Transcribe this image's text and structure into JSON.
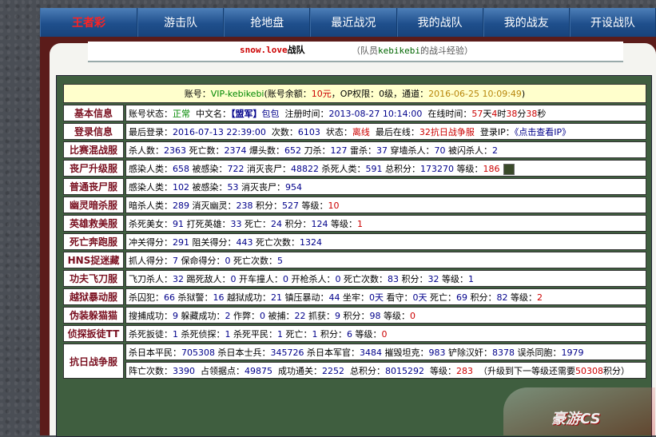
{
  "nav": {
    "items": [
      "王者彩",
      "游击队",
      "抢地盘",
      "最近战况",
      "我的战队",
      "我的战友",
      "开设战队"
    ]
  },
  "tab": {
    "squad_name": "snow.love",
    "squad_suffix": "战队",
    "sub_prefix": "（队员",
    "sub_member": "kebikebi",
    "sub_suffix": "的战斗经验）"
  },
  "account": {
    "label": "账号：",
    "id": "VIP-kebikebi",
    "balance_label": "(账号余额：",
    "balance": "10元",
    "op_label": "，OP权限：",
    "op": "0级",
    "channel_label": "，通道：",
    "channel": "2016-06-25 10:09:49",
    "end": ")"
  },
  "rows": [
    {
      "label": "基本信息"
    },
    {
      "label": "登录信息"
    },
    {
      "label": "比赛混战服"
    },
    {
      "label": "丧尸升级服"
    },
    {
      "label": "普通丧尸服"
    },
    {
      "label": "幽灵暗杀服"
    },
    {
      "label": "英雄救美服"
    },
    {
      "label": "死亡奔跑服"
    },
    {
      "label": "HNS捉迷藏"
    },
    {
      "label": "功夫飞刀服"
    },
    {
      "label": "越狱暴动服"
    },
    {
      "label": "伪装躲猫猫"
    },
    {
      "label": "侦探扳徒TT"
    },
    {
      "label": "抗日战争服"
    }
  ],
  "basic": {
    "status_label": "账号状态：",
    "status": "正常",
    "cn_label": "中文名：",
    "cn_tag": "【盟军】",
    "cn_name": "包包",
    "reg_label": "注册时间：",
    "reg": "2013-08-27 10:14:00",
    "online_label": "在线时间：",
    "d": "57",
    "d_u": "天",
    "h": "4",
    "h_u": "时",
    "m": "38",
    "m_u": "分",
    "s": "38",
    "s_u": "秒"
  },
  "login": {
    "last_label": "最后登录：",
    "last": "2016-07-13 22:39:00",
    "count_label": "次数：",
    "count": "6103",
    "state_label": "状态：",
    "state": "离线",
    "where_label": "最后在线：",
    "where": "32抗日战争服",
    "ip_label": "登录IP：",
    "ip": "《点击查看IP》"
  },
  "r3": [
    {
      "k": "杀人数：",
      "v": "2363"
    },
    {
      "k": "死亡数：",
      "v": "2374"
    },
    {
      "k": "爆头数：",
      "v": "652"
    },
    {
      "k": "刀杀：",
      "v": "127"
    },
    {
      "k": "雷杀：",
      "v": "37"
    },
    {
      "k": "穿墙杀人：",
      "v": "70"
    },
    {
      "k": "被闪杀人：",
      "v": "2"
    }
  ],
  "r4": [
    {
      "k": "感染人类：",
      "v": "658"
    },
    {
      "k": "被感染：",
      "v": "722"
    },
    {
      "k": "消灭丧尸：",
      "v": "48822"
    },
    {
      "k": "杀死人类：",
      "v": "591"
    },
    {
      "k": "总积分：",
      "v": "173270"
    },
    {
      "k": "等级：",
      "v": "186",
      "red": true
    }
  ],
  "r5": [
    {
      "k": "感染人类：",
      "v": "102"
    },
    {
      "k": "被感染：",
      "v": "53"
    },
    {
      "k": "消灭丧尸：",
      "v": "954"
    }
  ],
  "r6": [
    {
      "k": "暗杀人类：",
      "v": "289"
    },
    {
      "k": "消灭幽灵：",
      "v": "238"
    },
    {
      "k": "积分：",
      "v": "527"
    },
    {
      "k": "等级：",
      "v": "10",
      "red": true
    }
  ],
  "r7": [
    {
      "k": "杀死美女：",
      "v": "91"
    },
    {
      "k": "打死英雄：",
      "v": "33"
    },
    {
      "k": "死亡：",
      "v": "24"
    },
    {
      "k": "积分：",
      "v": "124"
    },
    {
      "k": "等级：",
      "v": "1",
      "red": true
    }
  ],
  "r8": [
    {
      "k": "冲关得分：",
      "v": "291"
    },
    {
      "k": "阻关得分：",
      "v": "443"
    },
    {
      "k": "死亡次数：",
      "v": "1324"
    }
  ],
  "r9": [
    {
      "k": "抓人得分：",
      "v": "7"
    },
    {
      "k": "保命得分：",
      "v": "0"
    },
    {
      "k": "死亡次数：",
      "v": "5"
    }
  ],
  "r10": [
    {
      "k": "飞刀杀人：",
      "v": "32"
    },
    {
      "k": "踢死敌人：",
      "v": "0"
    },
    {
      "k": "开车撞人：",
      "v": "0"
    },
    {
      "k": "开枪杀人：",
      "v": "0"
    },
    {
      "k": "死亡次数：",
      "v": "83"
    },
    {
      "k": "积分：",
      "v": "32"
    },
    {
      "k": "等级：",
      "v": "1"
    }
  ],
  "r11": [
    {
      "k": "杀囚犯：",
      "v": "66"
    },
    {
      "k": "杀狱警：",
      "v": "16"
    },
    {
      "k": "越狱成功：",
      "v": "21"
    },
    {
      "k": "镇压暴动：",
      "v": "44"
    },
    {
      "k": "坐牢：",
      "v": "0天"
    },
    {
      "k": "看守：",
      "v": "0天"
    },
    {
      "k": "死亡：",
      "v": "69"
    },
    {
      "k": "积分：",
      "v": "82"
    },
    {
      "k": "等级：",
      "v": "2",
      "red": true
    }
  ],
  "r12": [
    {
      "k": "搜捕成功：",
      "v": "9"
    },
    {
      "k": "躲藏成功：",
      "v": "2"
    },
    {
      "k": "作弊：",
      "v": "0"
    },
    {
      "k": "被捕：",
      "v": "22"
    },
    {
      "k": "抓获：",
      "v": "9"
    },
    {
      "k": "积分：",
      "v": "98"
    },
    {
      "k": "等级：",
      "v": "0",
      "red": true
    }
  ],
  "r13": [
    {
      "k": "杀死扳徒：",
      "v": "1"
    },
    {
      "k": "杀死侦探：",
      "v": "1"
    },
    {
      "k": "杀死平民：",
      "v": "1"
    },
    {
      "k": "死亡：",
      "v": "1"
    },
    {
      "k": "积分：",
      "v": "6"
    },
    {
      "k": "等级：",
      "v": "0",
      "red": true
    }
  ],
  "r14a": [
    {
      "k": "杀日本平民：",
      "v": "705308"
    },
    {
      "k": "杀日本士兵：",
      "v": "345726"
    },
    {
      "k": "杀日本军官：",
      "v": "3484"
    },
    {
      "k": "摧毁坦克：",
      "v": "983"
    },
    {
      "k": "铲除汉奸：",
      "v": "8378"
    },
    {
      "k": "误杀同胞：",
      "v": "1979"
    }
  ],
  "r14b": {
    "k1": "阵亡次数：",
    "v1": "3390",
    "k2": "占领据点：",
    "v2": "49875",
    "k3": "成功通关：",
    "v3": "2252",
    "k4": "总积分：",
    "v4": "8015292",
    "k5": "等级：",
    "v5": "283",
    "up_pre": "（升级到下一等级还需要",
    "up_v": "50308",
    "up_suf": "积分）"
  },
  "logo": {
    "text": "豪游CS"
  }
}
